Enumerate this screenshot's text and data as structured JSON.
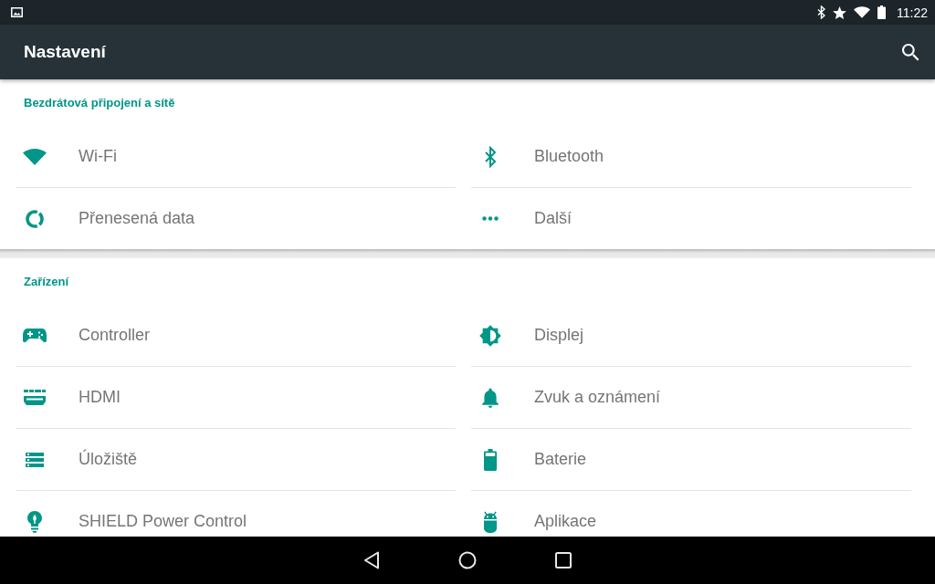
{
  "status_bar": {
    "time": "11:22"
  },
  "app_bar": {
    "title": "Nastavení"
  },
  "sections": [
    {
      "title": "Bezdrátová připojení a sítě",
      "items": [
        {
          "kind": "wifi",
          "label": "Wi-Fi"
        },
        {
          "kind": "bluetooth",
          "label": "Bluetooth"
        },
        {
          "kind": "data",
          "label": "Přenesená data"
        },
        {
          "kind": "more",
          "label": "Další"
        }
      ]
    },
    {
      "title": "Zařízení",
      "items": [
        {
          "kind": "controller",
          "label": "Controller"
        },
        {
          "kind": "display",
          "label": "Displej"
        },
        {
          "kind": "hdmi",
          "label": "HDMI"
        },
        {
          "kind": "sound",
          "label": "Zvuk a oznámení"
        },
        {
          "kind": "storage",
          "label": "Úložiště"
        },
        {
          "kind": "battery",
          "label": "Baterie"
        },
        {
          "kind": "power",
          "label": "SHIELD Power Control"
        },
        {
          "kind": "apps",
          "label": "Aplikace"
        }
      ]
    }
  ]
}
